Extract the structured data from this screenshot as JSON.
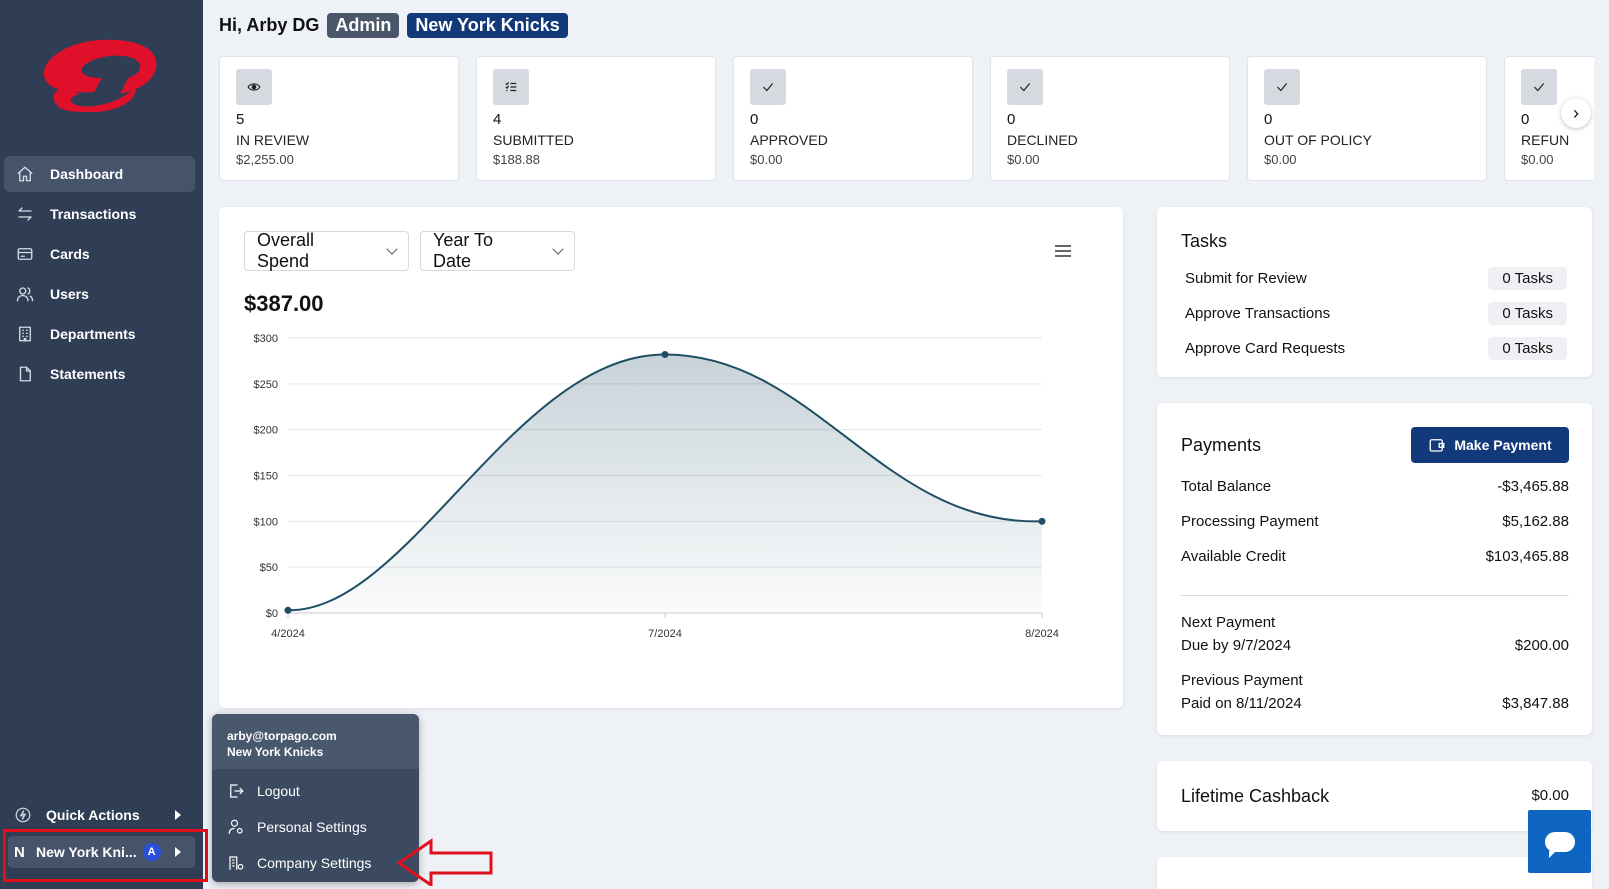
{
  "sidebar": {
    "items": [
      {
        "label": "Dashboard",
        "icon": "home-icon",
        "active": true
      },
      {
        "label": "Transactions",
        "icon": "transfer-icon"
      },
      {
        "label": "Cards",
        "icon": "card-icon"
      },
      {
        "label": "Users",
        "icon": "users-icon"
      },
      {
        "label": "Departments",
        "icon": "building-icon"
      },
      {
        "label": "Statements",
        "icon": "document-icon"
      }
    ],
    "quick_actions": "Quick Actions",
    "company_initial": "N",
    "company_name": "New York Kni...",
    "company_badge": "A"
  },
  "header": {
    "greeting": "Hi, Arby DG",
    "role_badge": "Admin",
    "team_badge": "New York Knicks"
  },
  "stats": [
    {
      "count": "5",
      "label": "IN REVIEW",
      "amount": "$2,255.00",
      "icon": "eye-icon"
    },
    {
      "count": "4",
      "label": "SUBMITTED",
      "amount": "$188.88",
      "icon": "list-check-icon"
    },
    {
      "count": "0",
      "label": "APPROVED",
      "amount": "$0.00",
      "icon": "check-icon"
    },
    {
      "count": "0",
      "label": "DECLINED",
      "amount": "$0.00",
      "icon": "check-icon"
    },
    {
      "count": "0",
      "label": "OUT OF POLICY",
      "amount": "$0.00",
      "icon": "check-icon"
    },
    {
      "count": "0",
      "label": "REFUN",
      "amount": "$0.00",
      "icon": "check-icon"
    }
  ],
  "chart_card": {
    "metric_select": "Overall Spend",
    "period_select": "Year To Date",
    "total": "$387.00"
  },
  "chart_data": {
    "type": "area",
    "x": [
      "4/2024",
      "7/2024",
      "8/2024"
    ],
    "y_tick_labels": [
      "$0",
      "$50",
      "$100",
      "$150",
      "$200",
      "$250",
      "$300"
    ],
    "values": [
      3,
      282,
      100
    ],
    "ylim": [
      0,
      300
    ],
    "grid": true,
    "color": "#1f4e63"
  },
  "tasks": {
    "title": "Tasks",
    "rows": [
      {
        "label": "Submit for Review",
        "value": "0 Tasks"
      },
      {
        "label": "Approve Transactions",
        "value": "0 Tasks"
      },
      {
        "label": "Approve Card Requests",
        "value": "0 Tasks"
      }
    ]
  },
  "payments": {
    "title": "Payments",
    "button": "Make Payment",
    "total_balance_label": "Total Balance",
    "total_balance": "-$3,465.88",
    "processing_label": "Processing Payment",
    "processing": "$5,162.88",
    "available_label": "Available Credit",
    "available": "$103,465.88",
    "next_label": "Next Payment",
    "next_due": "Due by 9/7/2024",
    "next_amount": "$200.00",
    "prev_label": "Previous Payment",
    "prev_paid": "Paid on 8/11/2024",
    "prev_amount": "$3,847.88"
  },
  "cashback": {
    "label": "Lifetime Cashback",
    "value": "$0.00"
  },
  "popup": {
    "email": "arby@torpago.com",
    "company": "New York Knicks",
    "items": [
      {
        "label": "Logout",
        "icon": "logout-icon"
      },
      {
        "label": "Personal Settings",
        "icon": "user-gear-icon"
      },
      {
        "label": "Company Settings",
        "icon": "building-gear-icon"
      }
    ]
  },
  "colors": {
    "sidebar": "#2f3e54",
    "brand_red": "#e0102a",
    "primary": "#123a7a",
    "highlight": "#e0101d"
  }
}
